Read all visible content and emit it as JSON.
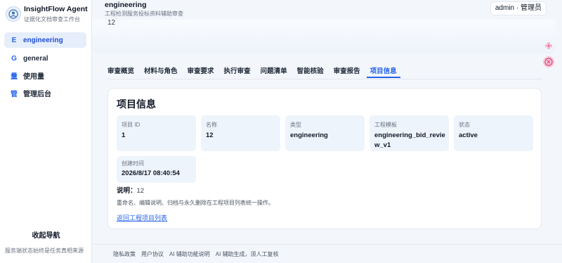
{
  "brand": {
    "title": "InsightFlow Agent",
    "subtitle": "证据化文档审查工作台"
  },
  "sidebar": {
    "items": [
      {
        "badge": "E",
        "label": "engineering",
        "active": true
      },
      {
        "badge": "G",
        "label": "general",
        "active": false
      },
      {
        "badge": "量",
        "label": "使用量",
        "active": false
      },
      {
        "badge": "管",
        "label": "管理后台",
        "active": false
      }
    ],
    "collapse_label": "收起导航",
    "footer": "服务端状态始终是任务真相来源"
  },
  "header": {
    "title": "engineering",
    "subtitle": "工程检测服务投标资料辅助审查",
    "user": "admin · 管理员",
    "value": "12"
  },
  "tabs": [
    "审查概览",
    "材料与角色",
    "审查要求",
    "执行审查",
    "问题清单",
    "智能核验",
    "审查报告",
    "项目信息"
  ],
  "active_tab": "项目信息",
  "card": {
    "title": "项目信息",
    "fields": [
      {
        "key": "项目 ID",
        "value": "1"
      },
      {
        "key": "名称",
        "value": "12"
      },
      {
        "key": "类型",
        "value": "engineering"
      },
      {
        "key": "工程模板",
        "value": "engineering_bid_review_v1"
      },
      {
        "key": "状态",
        "value": "active"
      },
      {
        "key": "创建时间",
        "value": "2026/8/17 08:40:54"
      }
    ],
    "desc_label": "说明：",
    "desc_value": "12",
    "note": "重命名、编辑说明、归档与永久删除在工程项目列表统一操作。",
    "back_link": "返回工程项目列表"
  },
  "footer": [
    "隐私政策",
    "用户协议",
    "AI 辅助功能说明",
    "AI 辅助生成，须人工复核"
  ],
  "colors": {
    "accent": "#2563eb",
    "active_bg": "#e6eefb",
    "field_bg": "#eef4fc"
  },
  "icons": {
    "floating_top": "flower-icon",
    "floating_bottom": "sakura-badge-icon"
  }
}
